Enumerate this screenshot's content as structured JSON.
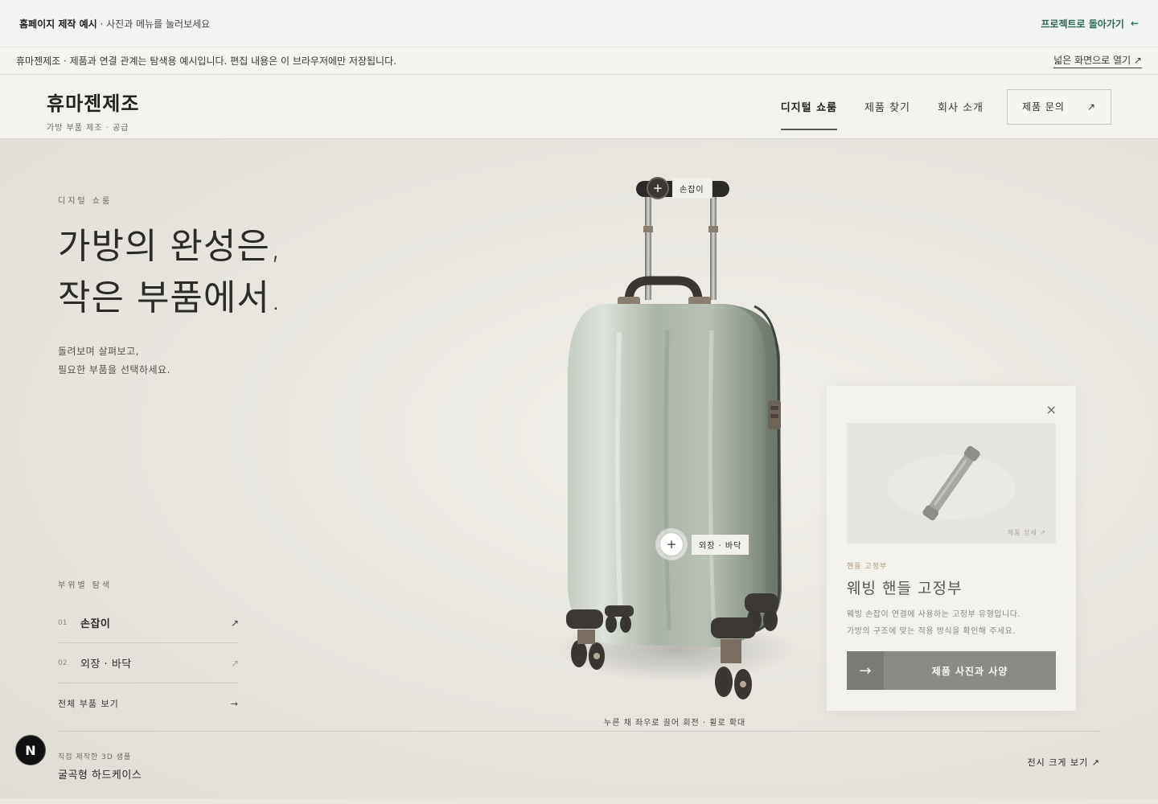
{
  "topbar": {
    "title": "홈페이지 제작 예시",
    "hint": " · 사진과 메뉴를 눌러보세요",
    "back_label": "프로젝트로 돌아가기",
    "back_icon": "←"
  },
  "notice": {
    "text": "휴마젠제조 · 제품과 연결 관계는 탐색용 예시입니다. 편집 내용은 이 브라우저에만 저장됩니다.",
    "open_wide": "넓은 화면으로 열기 ↗"
  },
  "brand": {
    "name": "휴마젠제조",
    "tagline": "가방 부품 제조 · 공급"
  },
  "nav": {
    "items": [
      "디지털 쇼룸",
      "제품 찾기",
      "회사 소개"
    ],
    "cta_label": "제품 문의",
    "cta_icon": "↗"
  },
  "hero": {
    "eyebrow": "디지털 쇼룸",
    "headline_line1": "가방의 완성은,",
    "headline_line2": "작은 부품에서.",
    "lead_line1": "돌려보며 살펴보고,",
    "lead_line2": "필요한 부품을 선택하세요."
  },
  "parts": {
    "title": "부위별 탐색",
    "items": [
      {
        "num": "01",
        "label": "손잡이",
        "arrow": "↗"
      },
      {
        "num": "02",
        "label": "외장 · 바닥",
        "arrow": "↗"
      }
    ],
    "all_label": "전체 부품 보기",
    "all_arrow": "→"
  },
  "hotspots": {
    "handle": {
      "plus": "+",
      "label": "손잡이"
    },
    "shell": {
      "plus": "+",
      "label": "외장 · 바닥"
    }
  },
  "hint": "누른 채 좌우로 끌어 회전 · 휠로 확대",
  "footer": {
    "sample_label": "직접 제작한 3D 샘플",
    "sample_name": "굴곡형 하드케이스",
    "big_view": "전시 크게 보기 ↗"
  },
  "badge": "N",
  "card": {
    "close": "×",
    "detail_link": "제품 상세 ↗",
    "category": "핸들 고정부",
    "title": "웨빙 핸들 고정부",
    "desc_line1": "웨빙 손잡이 연결에 사용하는 고정부 유형입니다.",
    "desc_line2": "가방의 구조에 맞는 적용 방식을 확인해 주세요.",
    "button_arrow": "→",
    "button_label": "제품 사진과 사양"
  },
  "colors": {
    "accent_green": "#2f6b58",
    "shell": "#a9b2a6",
    "button": "#8a8b84"
  }
}
